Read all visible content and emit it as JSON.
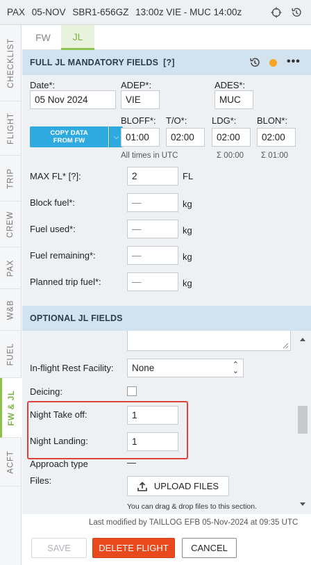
{
  "header": {
    "type": "PAX",
    "date": "05-NOV",
    "flight": "SBR1-656GZ",
    "route": "13:00z VIE - MUC 14:00z"
  },
  "side_tabs": [
    {
      "label": "CHECKLIST",
      "active": false
    },
    {
      "label": "FLIGHT",
      "active": false
    },
    {
      "label": "TRIP",
      "active": false
    },
    {
      "label": "CREW",
      "active": false
    },
    {
      "label": "PAX",
      "active": false
    },
    {
      "label": "W&B",
      "active": false
    },
    {
      "label": "FUEL",
      "active": false
    },
    {
      "label": "FW & JL",
      "active": true
    },
    {
      "label": "ACFT",
      "active": false
    }
  ],
  "tabs": [
    {
      "label": "FW",
      "active": false
    },
    {
      "label": "JL",
      "active": true
    }
  ],
  "mandatory": {
    "title": "FULL JL MANDATORY FIELDS",
    "help": "[?]",
    "status_color": "#f5a623",
    "date_label": "Date*:",
    "date_value": "05 Nov 2024",
    "adep_label": "ADEP*:",
    "adep_value": "VIE",
    "ades_label": "ADES*:",
    "ades_value": "MUC",
    "copy_label_1": "COPY DATA",
    "copy_label_2": "FROM FW",
    "bloff_label": "BLOFF*:",
    "bloff_value": "01:00",
    "to_label": "T/O*:",
    "to_value": "02:00",
    "ldg_label": "LDG*:",
    "ldg_value": "02:00",
    "blon_label": "BLON*:",
    "blon_value": "02:00",
    "utc_note": "All times in UTC",
    "sum_1": "Σ 00:00",
    "sum_2": "Σ 01:00",
    "max_fl_label": "MAX FL* [?]:",
    "max_fl_value": "2",
    "max_fl_unit": "FL",
    "block_fuel_label": "Block fuel*:",
    "block_fuel_value": "—",
    "fuel_used_label": "Fuel used*:",
    "fuel_used_value": "—",
    "fuel_remaining_label": "Fuel remaining*:",
    "fuel_remaining_value": "—",
    "planned_trip_label": "Planned trip fuel*:",
    "planned_trip_value": "—",
    "unit_kg": "kg"
  },
  "optional": {
    "title": "OPTIONAL JL FIELDS",
    "rest_label": "In-flight Rest Facility:",
    "rest_value": "None",
    "deicing_label": "Deicing:",
    "night_to_label": "Night Take off:",
    "night_to_value": "1",
    "night_ldg_label": "Night Landing:",
    "night_ldg_value": "1",
    "approach_label": "Approach type",
    "approach_value": "—",
    "files_label": "Files:",
    "upload_label": "UPLOAD FILES",
    "drop_hint": "You can drag & drop files to this section."
  },
  "footer": {
    "last_modified": "Last modified by TAILLOG EFB 05-Nov-2024 at 09:35 UTC",
    "save_label": "SAVE",
    "delete_label": "DELETE FLIGHT",
    "cancel_label": "CANCEL"
  }
}
